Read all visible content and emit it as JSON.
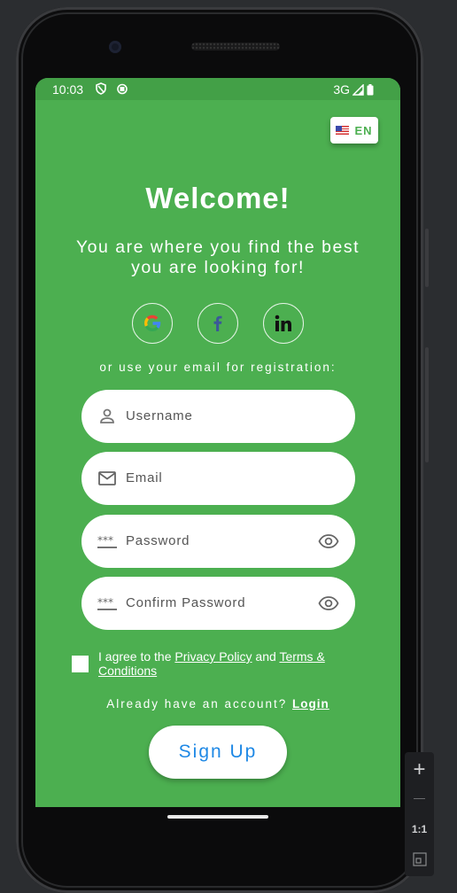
{
  "status_bar": {
    "time": "10:03",
    "network": "3G"
  },
  "language": {
    "code": "EN",
    "flag": "us-flag-icon"
  },
  "welcome": {
    "title": "Welcome!",
    "subtitle": "You are where you find the best you are looking for!"
  },
  "social": [
    {
      "name": "google",
      "icon": "google-icon"
    },
    {
      "name": "facebook",
      "icon": "facebook-icon"
    },
    {
      "name": "linkedin",
      "icon": "linkedin-icon"
    }
  ],
  "or_text": "or use your email for registration:",
  "form": {
    "username_placeholder": "Username",
    "email_placeholder": "Email",
    "password_placeholder": "Password",
    "confirm_password_placeholder": "Confirm Password"
  },
  "agreement": {
    "prefix": "I agree to the ",
    "privacy": "Privacy Policy",
    "and": " and ",
    "terms": "Terms & Conditions"
  },
  "login_prompt": {
    "text": "Already have an account? ",
    "link": "Login"
  },
  "signup_label": "Sign Up",
  "zoom_panel": {
    "ratio": "1:1"
  },
  "colors": {
    "background": "#4caf50",
    "status_bar": "#43a047",
    "primary_button_text": "#1e88e5"
  }
}
